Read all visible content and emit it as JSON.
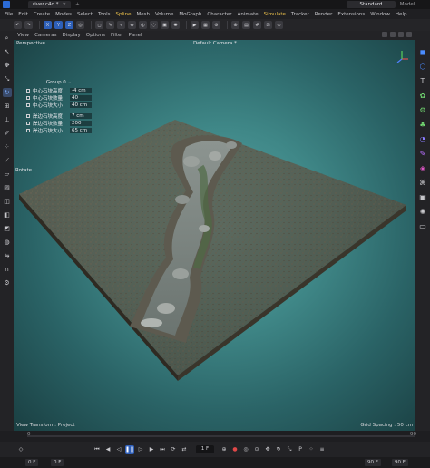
{
  "titlebar": {
    "doc_tab": "river.c4d *",
    "close": "×",
    "add": "+",
    "layout_active": "Standard",
    "layout_other": "Model"
  },
  "menu": {
    "items": [
      "File",
      "Edit",
      "Create",
      "Modes",
      "Select",
      "Tools",
      "Spline",
      "Mesh",
      "Volume",
      "MoGraph",
      "Character",
      "Animate",
      "Simulate",
      "Tracker",
      "Render",
      "Extensions",
      "Window",
      "Help"
    ]
  },
  "toolbar": {
    "axis_labels": [
      "X",
      "Y",
      "Z"
    ]
  },
  "viewport_menu": {
    "items": [
      "View",
      "Cameras",
      "Display",
      "Options",
      "Filter",
      "Panel"
    ]
  },
  "viewport": {
    "name": "Perspective",
    "camera": "Default Camera *",
    "grid_spacing": "Grid Spacing : 50 cm",
    "status": "View Transform: Project",
    "rotate_label": "Rotate"
  },
  "panel": {
    "header": "Group 0",
    "rows": [
      {
        "label": "中心石块高度",
        "value": "-4 cm"
      },
      {
        "label": "中心石块数量",
        "value": "40"
      },
      {
        "label": "中心石块大小",
        "value": "40 cm"
      },
      {
        "label": "岸边石块高度",
        "value": "7 cm"
      },
      {
        "label": "岸边石块数量",
        "value": "200"
      },
      {
        "label": "岸边石块大小",
        "value": "65 cm"
      }
    ]
  },
  "timeline": {
    "start_frame": "0",
    "end_frame": "90"
  },
  "transport": {
    "frame_field": "1 F"
  },
  "bottombar": {
    "left_a": "0 F",
    "left_b": "0 F",
    "right_a": "90 F",
    "right_b": "90 F"
  },
  "colors": {
    "accent": "#2d5fb8",
    "highlight": "#f0c44c",
    "viewport_bg": "#3f8787"
  }
}
